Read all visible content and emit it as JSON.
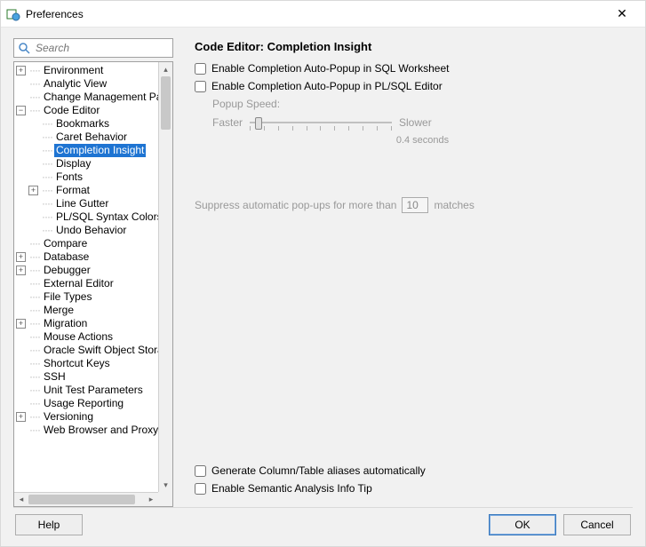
{
  "window": {
    "title": "Preferences"
  },
  "search": {
    "placeholder": "Search"
  },
  "tree": {
    "items": [
      {
        "indent": 0,
        "exp": "+",
        "label": "Environment"
      },
      {
        "indent": 0,
        "exp": "",
        "label": "Analytic View"
      },
      {
        "indent": 0,
        "exp": "",
        "label": "Change Management Parameters"
      },
      {
        "indent": 0,
        "exp": "-",
        "label": "Code Editor"
      },
      {
        "indent": 1,
        "exp": "",
        "label": "Bookmarks"
      },
      {
        "indent": 1,
        "exp": "",
        "label": "Caret Behavior"
      },
      {
        "indent": 1,
        "exp": "",
        "label": "Completion Insight",
        "selected": true
      },
      {
        "indent": 1,
        "exp": "",
        "label": "Display"
      },
      {
        "indent": 1,
        "exp": "",
        "label": "Fonts"
      },
      {
        "indent": 1,
        "exp": "+",
        "label": "Format"
      },
      {
        "indent": 1,
        "exp": "",
        "label": "Line Gutter"
      },
      {
        "indent": 1,
        "exp": "",
        "label": "PL/SQL Syntax Colors"
      },
      {
        "indent": 1,
        "exp": "",
        "label": "Undo Behavior"
      },
      {
        "indent": 0,
        "exp": "",
        "label": "Compare"
      },
      {
        "indent": 0,
        "exp": "+",
        "label": "Database"
      },
      {
        "indent": 0,
        "exp": "+",
        "label": "Debugger"
      },
      {
        "indent": 0,
        "exp": "",
        "label": "External Editor"
      },
      {
        "indent": 0,
        "exp": "",
        "label": "File Types"
      },
      {
        "indent": 0,
        "exp": "",
        "label": "Merge"
      },
      {
        "indent": 0,
        "exp": "+",
        "label": "Migration"
      },
      {
        "indent": 0,
        "exp": "",
        "label": "Mouse Actions"
      },
      {
        "indent": 0,
        "exp": "",
        "label": "Oracle Swift Object Storage"
      },
      {
        "indent": 0,
        "exp": "",
        "label": "Shortcut Keys"
      },
      {
        "indent": 0,
        "exp": "",
        "label": "SSH"
      },
      {
        "indent": 0,
        "exp": "",
        "label": "Unit Test Parameters"
      },
      {
        "indent": 0,
        "exp": "",
        "label": "Usage Reporting"
      },
      {
        "indent": 0,
        "exp": "+",
        "label": "Versioning"
      },
      {
        "indent": 0,
        "exp": "",
        "label": "Web Browser and Proxy"
      }
    ]
  },
  "main": {
    "heading": "Code Editor: Completion Insight",
    "check_sql": "Enable Completion Auto-Popup in SQL Worksheet",
    "check_plsql": "Enable Completion Auto-Popup in PL/SQL Editor",
    "speed_label": "Popup Speed:",
    "speed_faster": "Faster",
    "speed_slower": "Slower",
    "speed_caption": "0.4 seconds",
    "suppress_pre": "Suppress automatic pop-ups for more than",
    "suppress_value": "10",
    "suppress_post": "matches",
    "check_aliases": "Generate Column/Table aliases automatically",
    "check_semantic": "Enable Semantic Analysis Info Tip"
  },
  "buttons": {
    "help": "Help",
    "ok": "OK",
    "cancel": "Cancel"
  }
}
